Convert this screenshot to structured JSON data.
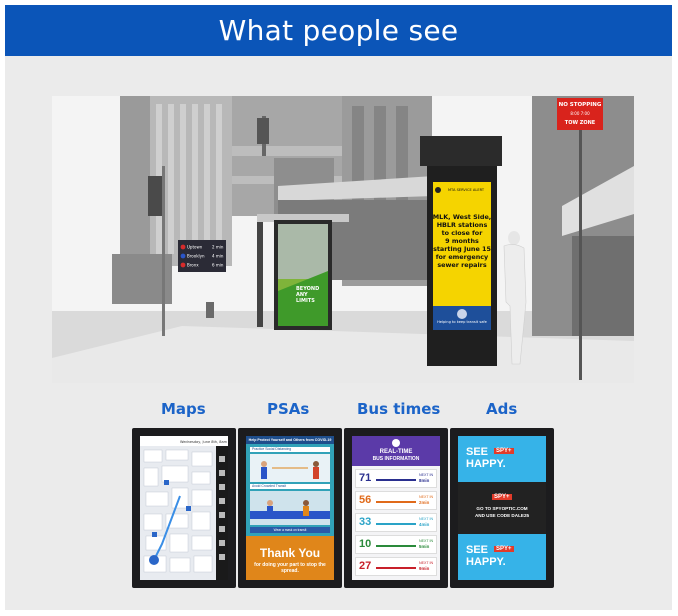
{
  "header": {
    "title": "What people see"
  },
  "scene": {
    "no_stopping_sign": {
      "line1": "NO STOPPING",
      "line2": "8:00 7:00",
      "line3": "TOW ZONE"
    },
    "poster_text": {
      "line1": "BEYOND",
      "line2": "ANY",
      "line3": "LIMITS"
    },
    "alert_header": "MTA SERVICE ALERT",
    "alert_lines": [
      "MLK, West Side,",
      "HBLR stations",
      "to close for",
      "9 months",
      "starting June 15",
      "for emergency",
      "sewer repairs"
    ],
    "alert_footer": "Helping to keep transit safe",
    "departures": [
      {
        "route": "1",
        "name": "Uptown",
        "time": "2 min"
      },
      {
        "route": "2",
        "name": "Brooklyn",
        "time": "4 min"
      },
      {
        "route": "3",
        "name": "Bronx",
        "time": "6 min"
      }
    ]
  },
  "categories": [
    "Maps",
    "PSAs",
    "Bus times",
    "Ads"
  ],
  "maps_screen": {
    "top_text": "Wednesday, June 8th, 8am"
  },
  "psa_screen": {
    "header": "Help Protect Yourself and Others from COVID-19",
    "sub1": "Practice Social Distancing",
    "sub2": "Avoid Crowded Transit",
    "line": "Wear a mask on transit",
    "thanks": "Thank You",
    "sub_thanks": "for doing your part to stop the spread."
  },
  "bus_screen": {
    "title_line1": "REAL-TIME",
    "title_line2": "BUS INFORMATION",
    "routes": [
      {
        "number": "71",
        "color": "#2a2f8f",
        "next": "NEXT IN",
        "mins": "8min"
      },
      {
        "number": "56",
        "color": "#e06a1a",
        "next": "NEXT IN",
        "mins": "2min"
      },
      {
        "number": "33",
        "color": "#2aa3c7",
        "next": "NEXT IN",
        "mins": "4min"
      },
      {
        "number": "10",
        "color": "#2a8a3a",
        "next": "NEXT IN",
        "mins": "5min"
      },
      {
        "number": "27",
        "color": "#c8202a",
        "next": "NEXT IN",
        "mins": "9min"
      }
    ]
  },
  "ads_screen": {
    "see": "SEE",
    "happy": "HAPPY.",
    "brand": "SPY+",
    "goto": "GO TO SPYOPTIC.COM",
    "code": "AND USE CODE DALE25"
  },
  "colors": {
    "header_bg": "#0b55b8",
    "label": "#1c64c8",
    "panel": "#ebebeb",
    "ad_blue": "#36b3e8",
    "alert_yellow": "#f5d400"
  }
}
